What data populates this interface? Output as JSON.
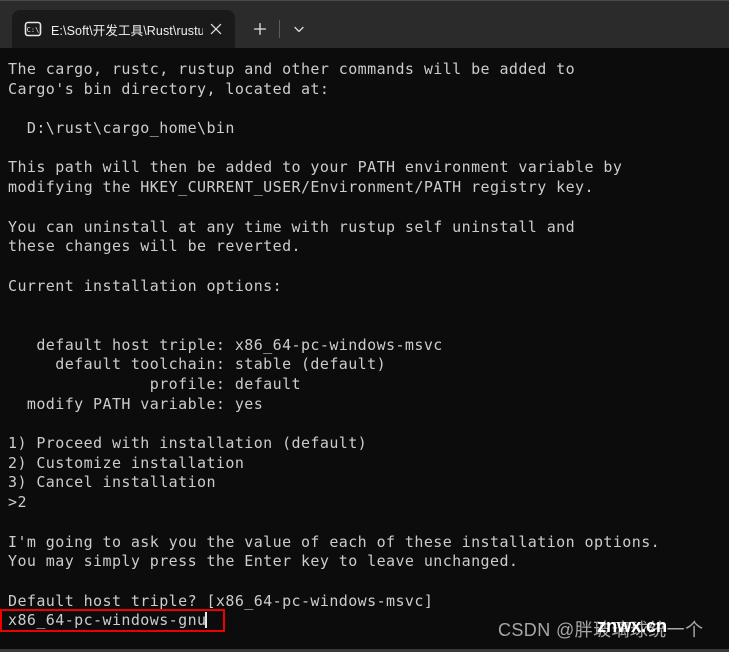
{
  "window": {
    "titlebar_color": "#2b2b2b",
    "terminal_background": "#0c0c0c",
    "terminal_foreground": "#cccccc"
  },
  "tab": {
    "icon": "command-prompt-icon",
    "icon_label": "C:\\",
    "title": "E:\\Soft\\开发工具\\Rust\\rustup-",
    "close_icon": "close-icon"
  },
  "tabbar": {
    "new_tab_icon": "plus-icon",
    "dropdown_icon": "chevron-down-icon"
  },
  "terminal": {
    "lines": [
      "The cargo, rustc, rustup and other commands will be added to",
      "Cargo's bin directory, located at:",
      "",
      "  D:\\rust\\cargo_home\\bin",
      "",
      "This path will then be added to your PATH environment variable by",
      "modifying the HKEY_CURRENT_USER/Environment/PATH registry key.",
      "",
      "You can uninstall at any time with rustup self uninstall and",
      "these changes will be reverted.",
      "",
      "Current installation options:",
      "",
      "",
      "   default host triple: x86_64-pc-windows-msvc",
      "     default toolchain: stable (default)",
      "               profile: default",
      "  modify PATH variable: yes",
      "",
      "1) Proceed with installation (default)",
      "2) Customize installation",
      "3) Cancel installation",
      ">2",
      "",
      "I'm going to ask you the value of each of these installation options.",
      "You may simply press the Enter key to leave unchanged.",
      "",
      "Default host triple? [x86_64-pc-windows-msvc]"
    ],
    "answer_line": "x86_64-pc-windows-gnu",
    "highlight_color": "#ee0000"
  },
  "watermark": {
    "csdn": "CSDN @胖玻璃球统一个",
    "site": "znwx.cn"
  }
}
